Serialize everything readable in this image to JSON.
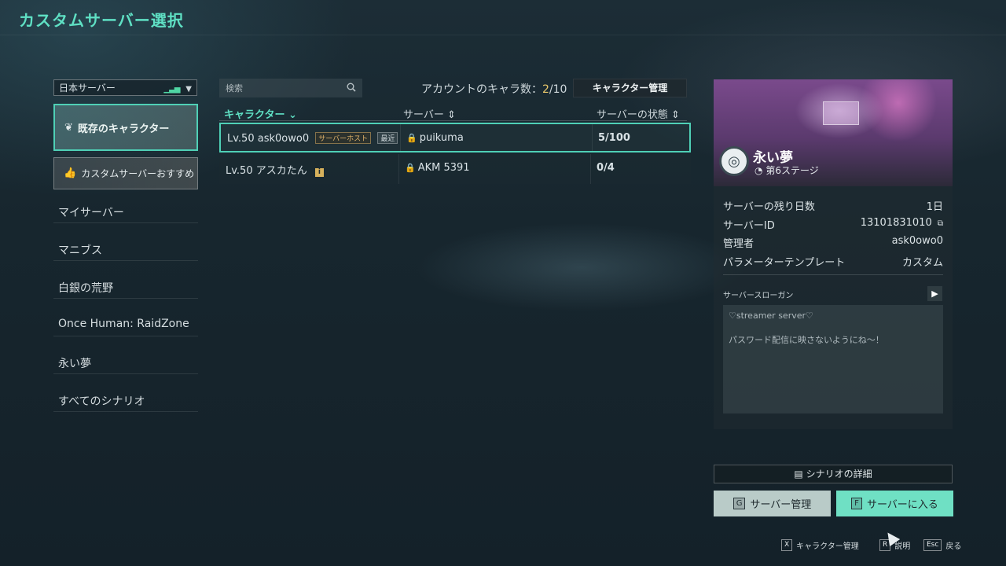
{
  "header": {
    "title": "カスタムサーバー選択"
  },
  "sidebar": {
    "region": {
      "label": "日本サーバー",
      "signal_icon": "signal-icon"
    },
    "existing_button": {
      "label": "既存のキャラクター",
      "icon": "wings-icon"
    },
    "recommend_button": {
      "label": "カスタムサーバーおすすめ",
      "icon": "thumbs-up-icon"
    },
    "menu": [
      {
        "label": "マイサーバー"
      },
      {
        "label": "マニブス"
      },
      {
        "label": "白銀の荒野"
      },
      {
        "label": "Once Human: RaidZone"
      },
      {
        "label": "永い夢"
      },
      {
        "label": "すべてのシナリオ"
      }
    ]
  },
  "toolbar": {
    "search_placeholder": "検索",
    "account_count_label": "アカウントのキャラ数：",
    "account_count_current": "2",
    "account_count_max": "/10",
    "character_manage_label": "キャラクター管理"
  },
  "table": {
    "columns": [
      {
        "label": "キャラクター ⌄"
      },
      {
        "label": "サーバー ⇕"
      },
      {
        "label": "サーバーの状態 ⇕"
      }
    ],
    "rows": [
      {
        "level": "Lv.50",
        "name": "ask0owo0",
        "tag_host": "サーバーホスト",
        "tag_recent": "最近",
        "server": "puikuma",
        "state": "5/100"
      },
      {
        "level": "Lv.50",
        "name": "アスカたん",
        "info": "i",
        "server": "AKM 5391",
        "state": "0/4"
      }
    ]
  },
  "server_panel": {
    "name": "永い夢",
    "stage": "第6ステージ",
    "info": [
      {
        "label": "サーバーの残り日数",
        "value": "1日"
      },
      {
        "label": "サーバーID",
        "value": "13101831010"
      },
      {
        "label": "管理者",
        "value": "ask0owo0"
      },
      {
        "label": "パラメーターテンプレート",
        "value": "カスタム"
      }
    ],
    "slogan_title": "サーバースローガン",
    "slogan_line1": "♡streamer server♡",
    "slogan_line2": "パスワード配信に映さないようにね〜！"
  },
  "actions": {
    "scenario_detail": "シナリオの詳細",
    "manage_key": "G",
    "manage_label": "サーバー管理",
    "enter_key": "F",
    "enter_label": "サーバーに入る"
  },
  "hints": [
    {
      "key": "X",
      "label": "キャラクター管理"
    },
    {
      "key": "R",
      "label": "説明"
    },
    {
      "key": "Esc",
      "label": "戻る"
    }
  ],
  "colors": {
    "accent": "#5fe0c4",
    "highlight": "#e7c66b",
    "host_tag": "#e0b36a"
  }
}
